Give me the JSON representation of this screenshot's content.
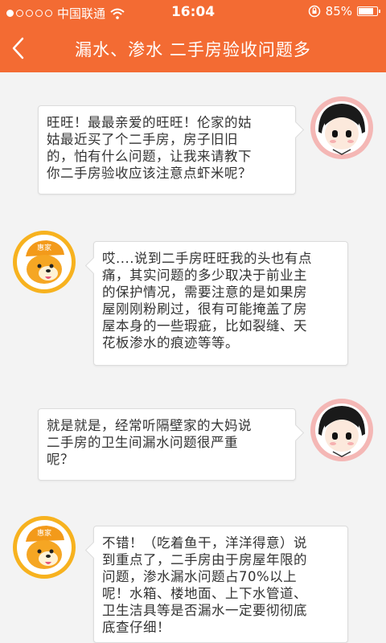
{
  "statusbar": {
    "carrier": "中国联通",
    "time": "16:04",
    "battery": "85%"
  },
  "navbar": {
    "title": "漏水、渗水 二手房验收问题多"
  },
  "messages": [
    {
      "sender": "girl",
      "text": "旺旺！最最亲爱的旺旺！伦家的姑\n姑最近买了个二手房，房子旧旧\n的，怕有什么问题，让我来请教下\n你二手房验收应该注意点虾米呢？"
    },
    {
      "sender": "dog",
      "text": "哎....说到二手房旺旺我的头也有点\n痛，其实问题的多少取决于前业主\n的保护情况，需要注意的是如果房\n屋刚刚粉刷过，很有可能掩盖了房\n屋本身的一些瑕疵，比如裂缝、天\n花板渗水的痕迹等等。"
    },
    {
      "sender": "girl",
      "text": "就是就是，经常听隔壁家的大妈说\n二手房的卫生间漏水问题很严重\n呢？"
    },
    {
      "sender": "dog",
      "text": "不错！（吃着鱼干，洋洋得意）说\n到重点了，二手房由于房屋年限的\n问题，渗水漏水问题占70%以上\n呢！水箱、楼地面、上下水管道、\n卫生洁具等是否漏水一定要彻彻底\n底查仔细！"
    }
  ],
  "avatars": {
    "dog_cap_text": "惠家"
  }
}
